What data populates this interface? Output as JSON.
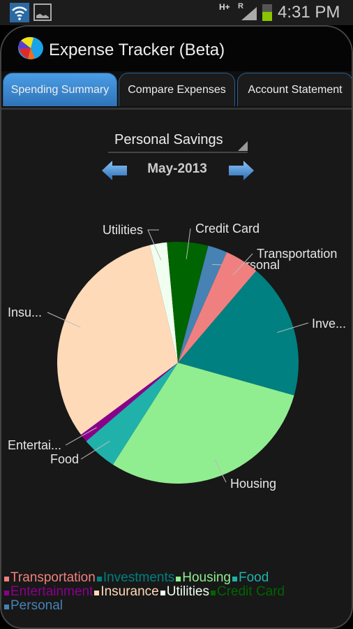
{
  "status_bar": {
    "time": "4:31 PM",
    "network": "H+",
    "roaming": "R",
    "icons": [
      "wifi-icon",
      "image-notification-icon",
      "data-activity-icon",
      "signal-icon",
      "battery-icon"
    ]
  },
  "app": {
    "title": "Expense Tracker (Beta)",
    "logo": "app-logo-icon"
  },
  "tabs": [
    {
      "label": "Spending Summary",
      "active": true
    },
    {
      "label": "Compare Expenses",
      "active": false
    },
    {
      "label": "Account Statement",
      "active": false
    }
  ],
  "account_selector": {
    "selected": "Personal Savings"
  },
  "period": {
    "label": "May-2013",
    "prev_icon": "arrow-left-icon",
    "next_icon": "arrow-right-icon"
  },
  "chart_data": {
    "type": "pie",
    "title": "",
    "start_angle_deg": -13.5,
    "direction": "clockwise",
    "slices": [
      {
        "name": "Utilities",
        "label": "Utilities",
        "value": 2.3,
        "color": "#f0fff0"
      },
      {
        "name": "Credit Card",
        "label": "Credit Card",
        "value": 5.5,
        "color": "#006400"
      },
      {
        "name": "Personal",
        "label": "Personal",
        "value": 2.6,
        "color": "#4682b4"
      },
      {
        "name": "Transportation",
        "label": "Transportation",
        "value": 4.6,
        "color": "#f08080"
      },
      {
        "name": "Investments",
        "label": "Inve...",
        "value": 18.1,
        "color": "#008080"
      },
      {
        "name": "Housing",
        "label": "Housing",
        "value": 29.7,
        "color": "#90ee90"
      },
      {
        "name": "Food",
        "label": "Food",
        "value": 4.7,
        "color": "#20b2aa"
      },
      {
        "name": "Entertainment",
        "label": "Entertai...",
        "value": 1.1,
        "color": "#8b008b"
      },
      {
        "name": "Insurance",
        "label": "Insu...",
        "value": 31.4,
        "color": "#ffdab9"
      }
    ],
    "legend": {
      "placement": "bottom",
      "entries": [
        {
          "label": "Transportation",
          "color": "#f08080"
        },
        {
          "label": "Investments",
          "color": "#008080"
        },
        {
          "label": "Housing",
          "color": "#90ee90"
        },
        {
          "label": "Food",
          "color": "#20b2aa"
        },
        {
          "label": "Entertainment",
          "color": "#8b008b"
        },
        {
          "label": "Insurance",
          "color": "#ffdab9"
        },
        {
          "label": "Utilities",
          "color": "#f0fff0"
        },
        {
          "label": "Credit Card",
          "color": "#006400"
        },
        {
          "label": "Personal",
          "color": "#4682b4"
        }
      ]
    }
  }
}
